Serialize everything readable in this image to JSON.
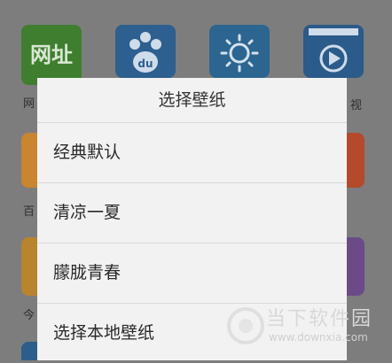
{
  "home": {
    "tile1_text": "网址",
    "cap_left_1": "网",
    "cap_left_2": "百",
    "cap_left_3": "今",
    "cap_right_1": "视"
  },
  "dialog": {
    "title": "选择壁纸",
    "options": [
      {
        "label": "经典默认"
      },
      {
        "label": "清凉一夏"
      },
      {
        "label": "朦胧青春"
      },
      {
        "label": "选择本地壁纸"
      }
    ]
  },
  "watermark": {
    "title": "当下软件园",
    "url": "www.downxia.com"
  },
  "colors": {
    "overlay": "#7d7d7d",
    "dialog_bg": "#f2f2f2",
    "divider": "#dadada"
  }
}
